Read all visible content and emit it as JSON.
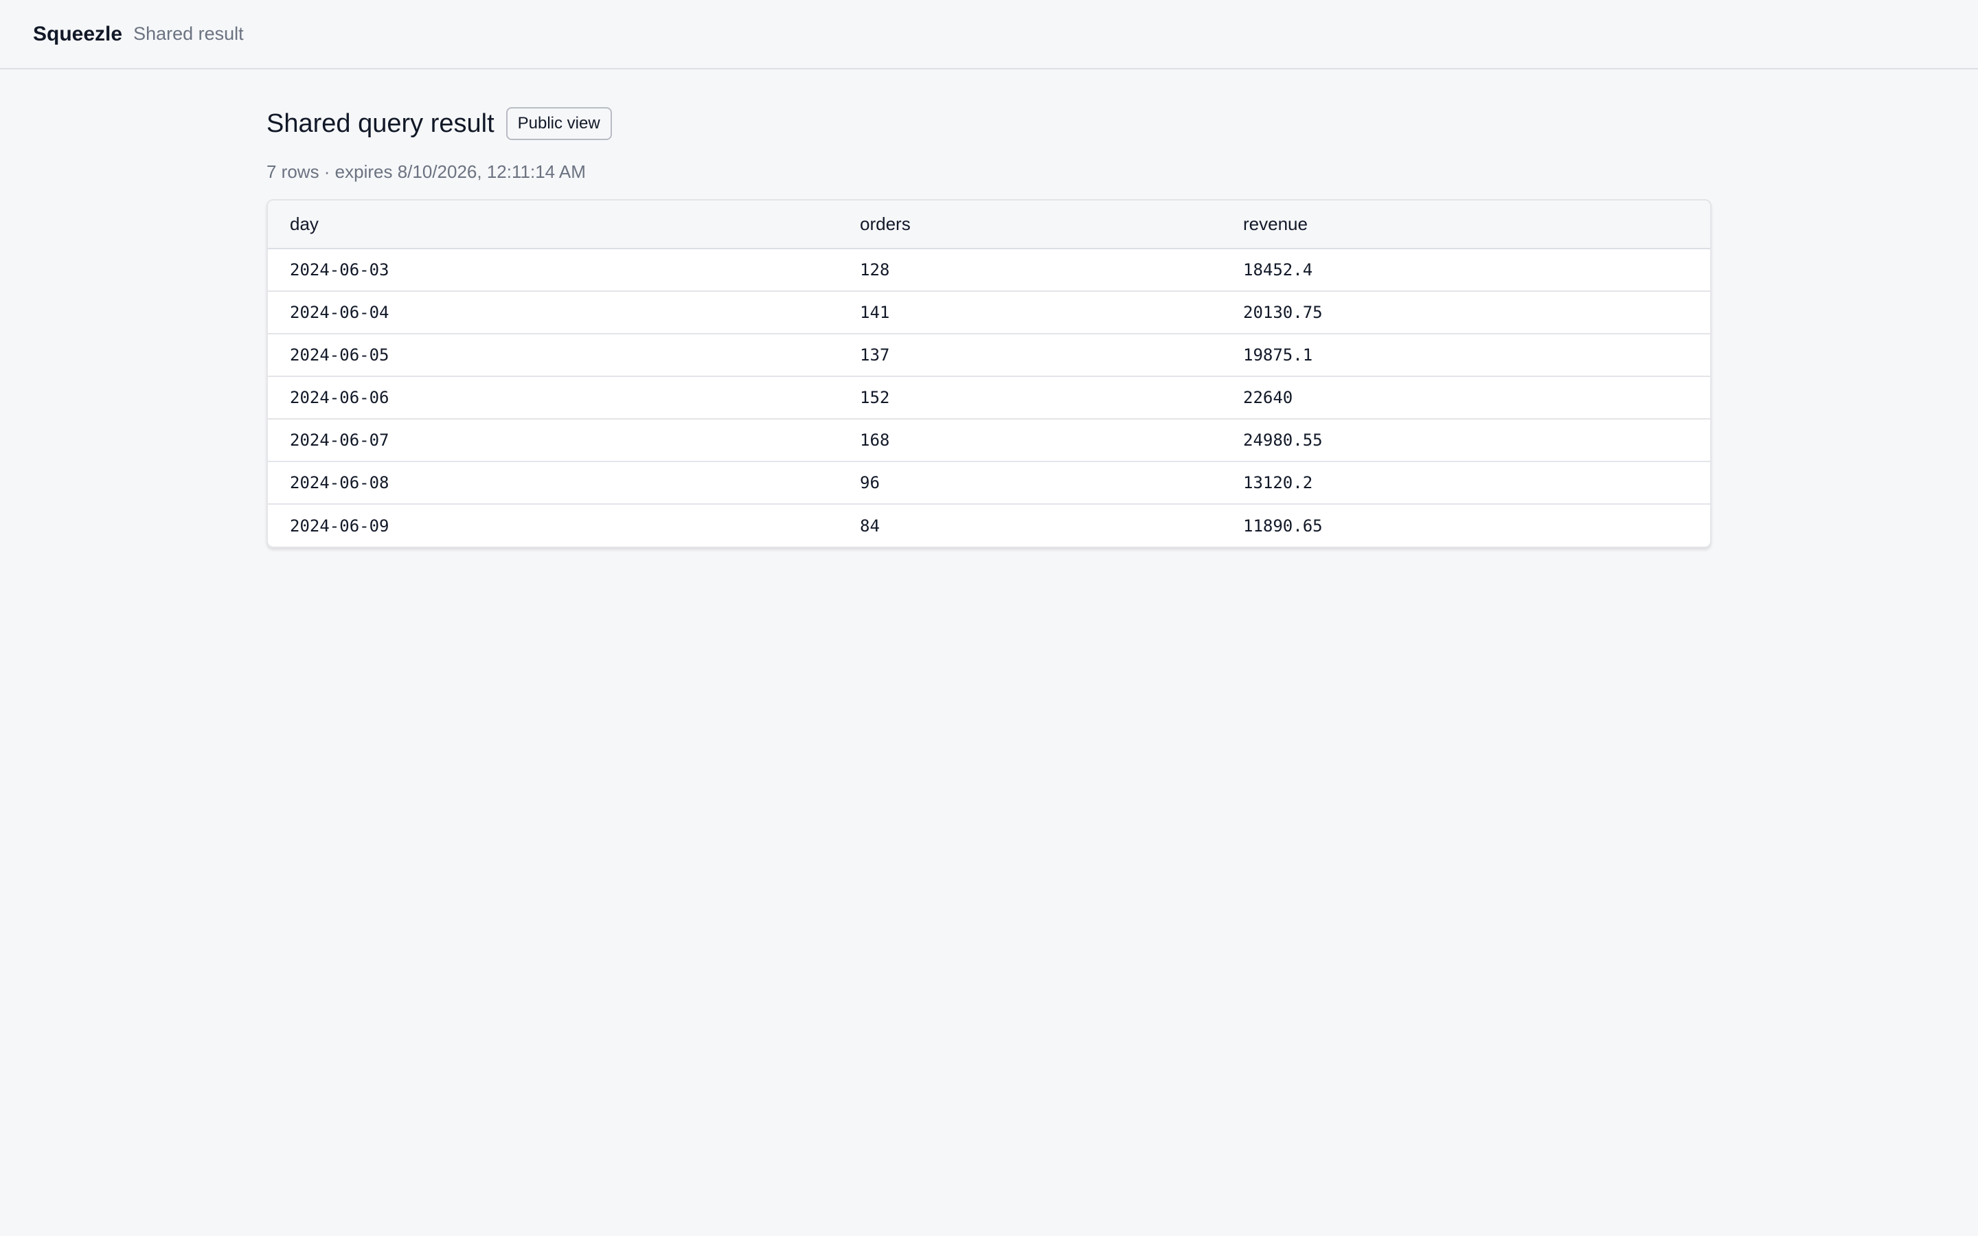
{
  "header": {
    "brand": "Squeezle",
    "subtitle": "Shared result"
  },
  "main": {
    "title": "Shared query result",
    "badge": "Public view",
    "meta": "7 rows · expires 8/10/2026, 12:11:14 AM"
  },
  "table": {
    "columns": [
      "day",
      "orders",
      "revenue"
    ],
    "rows": [
      [
        "2024-06-03",
        "128",
        "18452.4"
      ],
      [
        "2024-06-04",
        "141",
        "20130.75"
      ],
      [
        "2024-06-05",
        "137",
        "19875.1"
      ],
      [
        "2024-06-06",
        "152",
        "22640"
      ],
      [
        "2024-06-07",
        "168",
        "24980.55"
      ],
      [
        "2024-06-08",
        "96",
        "13120.2"
      ],
      [
        "2024-06-09",
        "84",
        "11890.65"
      ]
    ]
  }
}
